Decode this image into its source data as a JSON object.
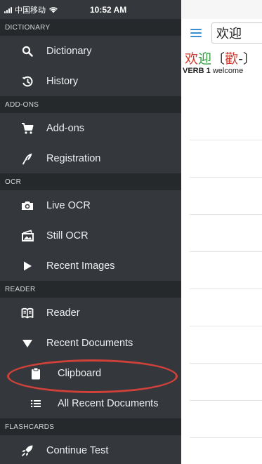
{
  "status_bar": {
    "carrier": "中国移动",
    "time": "10:52 AM"
  },
  "drawer": {
    "sections": [
      {
        "title": "DICTIONARY",
        "items": [
          {
            "label": "Dictionary",
            "icon": "search-icon"
          },
          {
            "label": "History",
            "icon": "history-icon"
          }
        ]
      },
      {
        "title": "ADD-ONS",
        "items": [
          {
            "label": "Add-ons",
            "icon": "cart-icon"
          },
          {
            "label": "Registration",
            "icon": "quill-icon"
          }
        ]
      },
      {
        "title": "OCR",
        "items": [
          {
            "label": "Live OCR",
            "icon": "camera-icon"
          },
          {
            "label": "Still OCR",
            "icon": "image-icon"
          },
          {
            "label": "Recent Images",
            "icon": "play-icon"
          }
        ]
      },
      {
        "title": "READER",
        "items": [
          {
            "label": "Reader",
            "icon": "book-icon"
          },
          {
            "label": "Recent Documents",
            "icon": "triangle-down-icon"
          },
          {
            "label": "Clipboard",
            "icon": "clipboard-icon"
          },
          {
            "label": "All Recent Documents",
            "icon": "list-icon"
          }
        ]
      },
      {
        "title": "FLASHCARDS",
        "items": [
          {
            "label": "Continue Test",
            "icon": "rocket-icon"
          }
        ]
      }
    ],
    "highlight_color": "#d0413a"
  },
  "main": {
    "search_value": "欢迎",
    "headword": {
      "simplified_1": "欢",
      "simplified_2": "迎",
      "traditional_open": "〔",
      "traditional": "歡",
      "traditional_close": "-〕"
    },
    "definition": {
      "pos": "VERB",
      "number": "1",
      "text": "welcome"
    }
  },
  "colors": {
    "drawer_bg": "#34373b",
    "section_bg": "#26292c",
    "accent": "#3a8fd1"
  }
}
